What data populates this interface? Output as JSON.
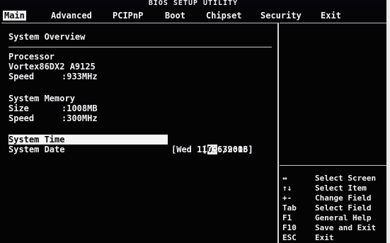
{
  "title": "BIOS SETUP UTILITY",
  "menu": [
    {
      "label": "Main",
      "active": true
    },
    {
      "label": "Advanced",
      "active": false
    },
    {
      "label": "PCIPnP",
      "active": false
    },
    {
      "label": "Boot",
      "active": false
    },
    {
      "label": "Chipset",
      "active": false
    },
    {
      "label": "Security",
      "active": false
    },
    {
      "label": "Exit",
      "active": false
    }
  ],
  "main": {
    "section_title": "System Overview",
    "processor": {
      "header": "Processor",
      "model": "Vortex86DX2 A9125",
      "speed_label": "Speed",
      "speed_value": ":933MHz"
    },
    "memory": {
      "header": "System Memory",
      "size_label": "Size",
      "size_value": ":1008MB",
      "speed_label": "Speed",
      "speed_value": ":300MHz"
    },
    "time": {
      "label": "System Time",
      "open": "[",
      "cursor_digits": "03",
      "rest": ":39:06]"
    },
    "date": {
      "label": "System Date",
      "value": "[Wed 11/06/2013]"
    }
  },
  "help": [
    {
      "key": "↔",
      "action": "Select Screen"
    },
    {
      "key": "↑↓",
      "action": "Select Item"
    },
    {
      "key": "+-",
      "action": "Change Field"
    },
    {
      "key": "Tab",
      "action": "Select Field"
    },
    {
      "key": "F1",
      "action": "General Help"
    },
    {
      "key": "F10",
      "action": "Save and Exit"
    },
    {
      "key": "ESC",
      "action": "Exit"
    }
  ]
}
